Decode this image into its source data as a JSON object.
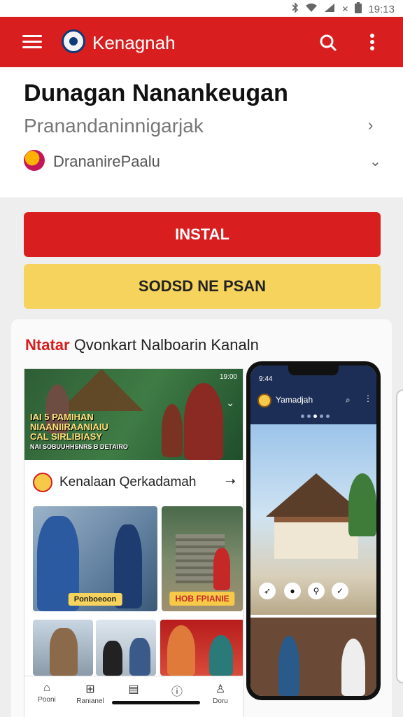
{
  "statusbar": {
    "icons": [
      "bluetooth-icon",
      "wifi-icon",
      "signal-icon",
      "battery-icon"
    ],
    "mute_glyph": "✕",
    "time": "19:13"
  },
  "appbar": {
    "title": "Kenagnah"
  },
  "header": {
    "title": "Dunagan Nanankeugan",
    "subtitle": "Pranandaninnigarjak",
    "developer": "DrananirePaalu"
  },
  "buttons": {
    "install": "INSTAL",
    "secondary": "SODSD NE PSAN"
  },
  "promo": {
    "title_highlight": "Ntatar",
    "title_rest": " Qvonkart Nalboarin Kanaln",
    "inner": {
      "banner_status": "19:00",
      "banner_text_line1": "IAI 5 PAMIHAN",
      "banner_text_line2": "NIAANIIRAANIAIU",
      "banner_text_line3": "CAL SIRLIBIASY",
      "banner_text_line4": "NAI SOBUUHHSNRS B DETAIRO",
      "section_title": "Kenalaan Qerkadamah",
      "tile_badges": [
        "Ponboeoon",
        "HOB FPIANIE"
      ],
      "nav": [
        "Pooni",
        "Ranianel",
        "",
        "",
        "Doru"
      ]
    },
    "phone": {
      "time": "9:44",
      "title": "Yamadjah",
      "carousel_count": 5,
      "carousel_active": 2
    }
  },
  "colors": {
    "primary": "#d81e1e",
    "secondary": "#f6d35c",
    "phone_bar": "#1c2e55"
  }
}
